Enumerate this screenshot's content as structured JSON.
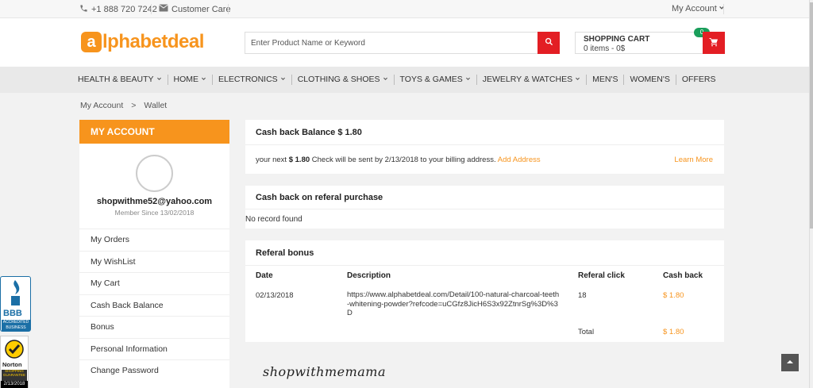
{
  "topbar": {
    "phone": "+1 888 720 7242",
    "customer_care": "Customer Care",
    "my_account": "My Account"
  },
  "logo": {
    "mark": "a",
    "text": "lphabetdeal",
    "color": "#f7941d"
  },
  "search": {
    "placeholder": "Enter Product Name or Keyword",
    "value": "",
    "icon": "search-icon"
  },
  "cart": {
    "title": "SHOPPING CART",
    "items": "0 items - 0$",
    "badge": "0",
    "icon": "cart-icon"
  },
  "nav": {
    "items": [
      {
        "label": "HEALTH & BEAUTY",
        "dropdown": true
      },
      {
        "label": "HOME",
        "dropdown": true
      },
      {
        "label": "ELECTRONICS",
        "dropdown": true
      },
      {
        "label": "CLOTHING & SHOES",
        "dropdown": true
      },
      {
        "label": "TOYS & GAMES",
        "dropdown": true
      },
      {
        "label": "JEWELRY & WATCHES",
        "dropdown": true
      },
      {
        "label": "MEN'S",
        "dropdown": false
      },
      {
        "label": "WOMEN'S",
        "dropdown": false
      },
      {
        "label": "OFFERS",
        "dropdown": false
      }
    ]
  },
  "breadcrumb": {
    "parent": "My Account",
    "separator": ">",
    "current": "Wallet"
  },
  "sidebar": {
    "title": "MY ACCOUNT",
    "email": "shopwithme52@yahoo.com",
    "member_since": "Member Since 13/02/2018",
    "menu": [
      "My Orders",
      "My WishList",
      "My Cart",
      "Cash Back Balance",
      "Bonus",
      "Personal Information",
      "Change Password"
    ]
  },
  "cashback": {
    "title": "Cash back Balance $ 1.80",
    "msg_prefix": "your next",
    "msg_amount": "$ 1.80",
    "msg_suffix": "Check will be sent by 2/13/2018 to your billing address.",
    "add_address": "Add Address",
    "learn_more": "Learn More"
  },
  "referral_purchase": {
    "title": "Cash back on referal purchase",
    "empty": "No record found"
  },
  "referral_bonus": {
    "title": "Referal bonus",
    "columns": [
      "Date",
      "Description",
      "Referal click",
      "Cash back"
    ],
    "rows": [
      {
        "date": "02/13/2018",
        "description": "https://www.alphabetdeal.com/Detail/100-natural-charcoal-teeth-whitening-powder?refcode=uCGfz8JicH6S3x92ZtnrSg%3D%3D",
        "clicks": "18",
        "cashback": "$ 1.80"
      }
    ],
    "total_label": "Total",
    "total_value": "$ 1.80"
  },
  "watermark": "shopwithmemama",
  "badges": {
    "bbb": "BBB",
    "bbb_sub": "ACCREDITED BUSINESS",
    "norton": "Norton",
    "norton_sub": "SHOPPING GUARANTEE",
    "norton_date": "2/13/2018"
  },
  "colors": {
    "accent": "#f7941d",
    "red": "#e31e24",
    "green": "#1a9e5b"
  }
}
